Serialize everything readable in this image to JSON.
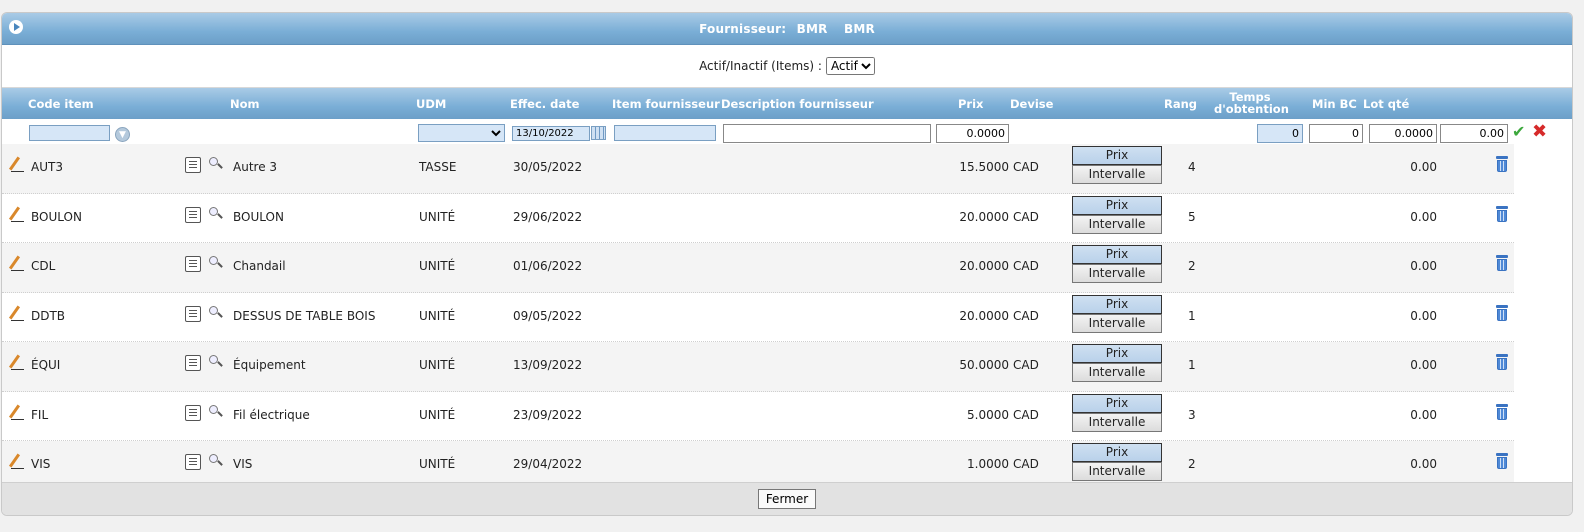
{
  "header": {
    "title_label": "Fournisseur:",
    "code": "BMR",
    "name": "BMR"
  },
  "filter": {
    "label": "Actif/Inactif (Items) :",
    "selected": "Actif",
    "options": [
      "Actif"
    ]
  },
  "columns": {
    "code": "Code item",
    "nom": "Nom",
    "udm": "UDM",
    "date": "Effec. date",
    "item_fournisseur": "Item fournisseur",
    "description": "Description fournisseur",
    "prix": "Prix",
    "devise": "Devise",
    "rang": "Rang",
    "temps_1": "Temps",
    "temps_2": "d'obtention",
    "min_bc": "Min BC",
    "lot_qte": "Lot qté"
  },
  "new_row": {
    "date": "13/10/2022",
    "prix": "0.0000",
    "temps": "0",
    "min_bc": "0",
    "lot_qte": "0.0000",
    "extra": "0.00"
  },
  "buttons": {
    "prix": "Prix",
    "intervalle": "Intervalle",
    "fermer": "Fermer"
  },
  "rows": [
    {
      "code": "AUT3",
      "nom": "Autre 3",
      "udm": "TASSE",
      "date": "30/05/2022",
      "prix": "15.5000",
      "devise": "CAD",
      "rang": "4",
      "lot": "0.00"
    },
    {
      "code": "BOULON",
      "nom": "BOULON",
      "udm": "UNITÉ",
      "date": "29/06/2022",
      "prix": "20.0000",
      "devise": "CAD",
      "rang": "5",
      "lot": "0.00"
    },
    {
      "code": "CDL",
      "nom": "Chandail",
      "udm": "UNITÉ",
      "date": "01/06/2022",
      "prix": "20.0000",
      "devise": "CAD",
      "rang": "2",
      "lot": "0.00"
    },
    {
      "code": "DDTB",
      "nom": "DESSUS DE TABLE BOIS",
      "udm": "UNITÉ",
      "date": "09/05/2022",
      "prix": "20.0000",
      "devise": "CAD",
      "rang": "1",
      "lot": "0.00"
    },
    {
      "code": "ÉQUI",
      "nom": "Équipement",
      "udm": "UNITÉ",
      "date": "13/09/2022",
      "prix": "50.0000",
      "devise": "CAD",
      "rang": "1",
      "lot": "0.00"
    },
    {
      "code": "FIL",
      "nom": "Fil électrique",
      "udm": "UNITÉ",
      "date": "23/09/2022",
      "prix": "5.0000",
      "devise": "CAD",
      "rang": "3",
      "lot": "0.00"
    },
    {
      "code": "VIS",
      "nom": "VIS",
      "udm": "UNITÉ",
      "date": "29/04/2022",
      "prix": "1.0000",
      "devise": "CAD",
      "rang": "2",
      "lot": "0.00"
    }
  ]
}
